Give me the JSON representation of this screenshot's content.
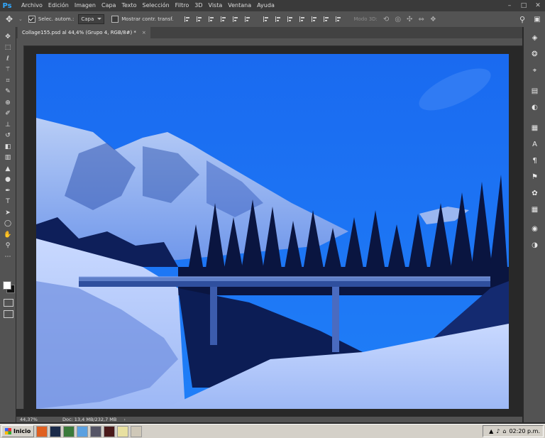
{
  "app": {
    "logo": "Ps"
  },
  "menu": [
    "Archivo",
    "Edición",
    "Imagen",
    "Capa",
    "Texto",
    "Selección",
    "Filtro",
    "3D",
    "Vista",
    "Ventana",
    "Ayuda"
  ],
  "window_controls": {
    "minimize": "–",
    "maximize": "□",
    "close": "✕"
  },
  "options_bar": {
    "tool_icon": "move-tool-icon",
    "auto_select_label": "Selec. autom.:",
    "auto_select_checked": true,
    "auto_select_value": "Capa",
    "show_transform_label": "Mostrar contr. transf.",
    "show_transform_checked": false,
    "mode3d_label": "Modo 3D:"
  },
  "document": {
    "tab_title": "Collage155.psd al 44,4% (Grupo 4, RGB/8#) *",
    "tab_close": "×",
    "zoom": "44,37%",
    "doc_info": "Doc: 13,4 MB/232,7 MB"
  },
  "tools": [
    "move-tool-icon",
    "marquee-tool-icon",
    "lasso-tool-icon",
    "magic-wand-icon",
    "crop-tool-icon",
    "eyedropper-icon",
    "healing-brush-icon",
    "brush-tool-icon",
    "clone-stamp-icon",
    "history-brush-icon",
    "eraser-icon",
    "gradient-tool-icon",
    "blur-tool-icon",
    "dodge-tool-icon",
    "pen-tool-icon",
    "type-tool-icon",
    "path-select-icon",
    "shape-tool-icon",
    "hand-tool-icon",
    "zoom-tool-icon",
    "more-tools-icon"
  ],
  "dock_icons": [
    "layers-icon",
    "channels-icon",
    "paths-icon",
    "properties-icon",
    "adjustments-icon",
    "libraries-icon",
    "character-icon",
    "paragraph-icon",
    "styles-icon",
    "swatches-icon",
    "color-icon",
    "histogram-icon"
  ],
  "taskbar": {
    "start_label": "Inicio",
    "clock": "02:20 p.m."
  },
  "colors": {
    "foreground": "#ffffff",
    "background": "#111111",
    "sky": "#1a6ef0"
  }
}
